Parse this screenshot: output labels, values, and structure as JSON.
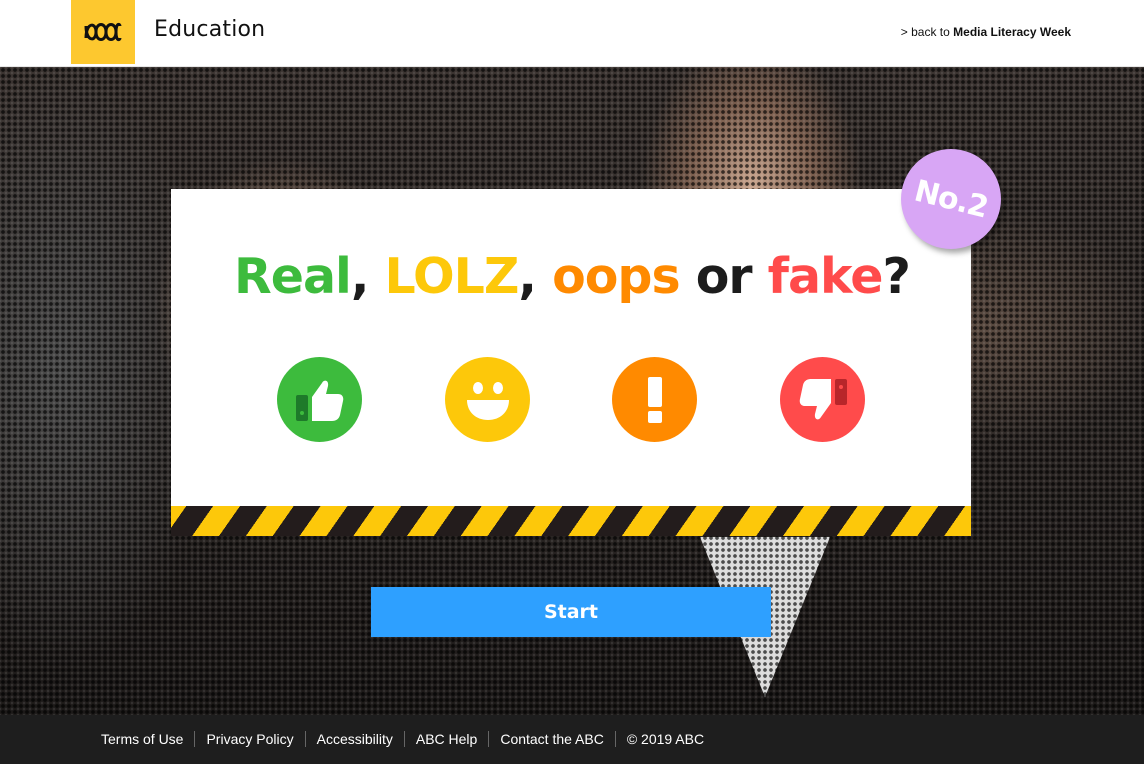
{
  "header": {
    "brand": "Education",
    "back_prefix": "> back to ",
    "back_link": "Media Literacy Week"
  },
  "quiz": {
    "badge": "No.2",
    "title_parts": {
      "real": "Real",
      "comma1": ",",
      "lolz": "LOLZ",
      "comma2": ",",
      "oops": "oops",
      "or": "or",
      "fake": "fake",
      "question": "?"
    },
    "icons": [
      "thumbs-up-icon",
      "smiley-face-icon",
      "exclamation-icon",
      "thumbs-down-icon"
    ],
    "colors": {
      "real": "#3dbb3d",
      "lolz": "#fdc80a",
      "oops": "#ff8a00",
      "fake": "#ff4b4b",
      "badge": "#d8a6f5",
      "start": "#2ea0ff"
    },
    "start_label": "Start"
  },
  "footer": {
    "links": [
      "Terms of Use",
      "Privacy Policy",
      "Accessibility",
      "ABC Help",
      "Contact the ABC"
    ],
    "copyright": "© 2019 ABC"
  }
}
